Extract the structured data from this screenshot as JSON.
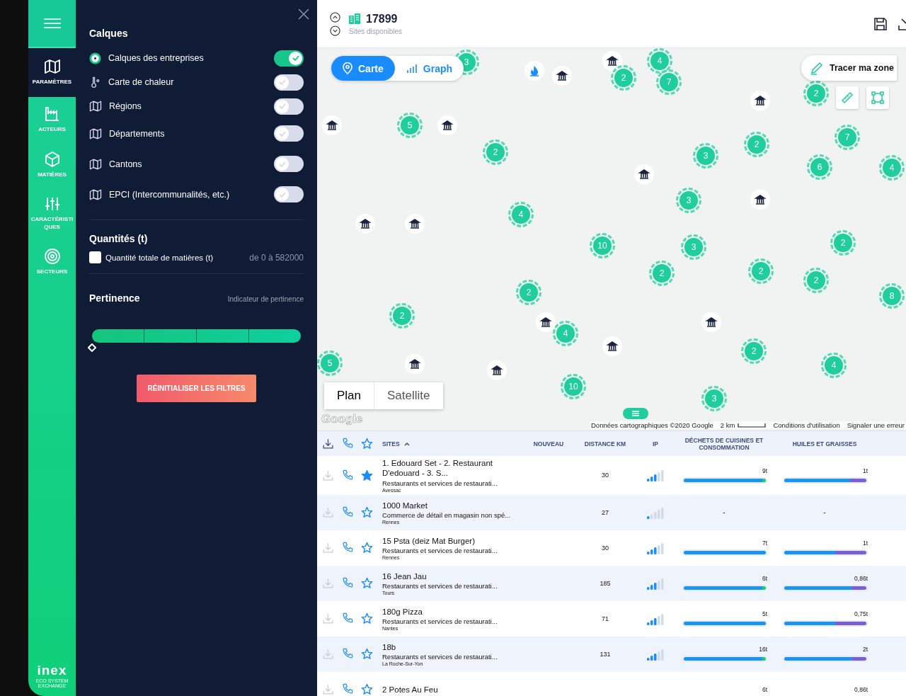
{
  "rail": {
    "items": [
      {
        "label": "PARAMÈTRES",
        "kind": "map",
        "selected": true
      },
      {
        "label": "ACTEURS",
        "kind": "factory",
        "selected": false
      },
      {
        "label": "MATIÈRES",
        "kind": "box",
        "selected": false
      },
      {
        "label": "CARACTÉRISTIQUES",
        "kind": "sliders",
        "selected": false
      },
      {
        "label": "SECTEURS",
        "kind": "target",
        "selected": false
      }
    ],
    "logo": "inex",
    "logo_tagline": "ECO SYSTEM EXCHANGE"
  },
  "panel": {
    "layers_title": "Calques",
    "layers": [
      {
        "label": "Calques des entreprises",
        "kind": "dot",
        "on": true
      },
      {
        "label": "Carte de chaleur",
        "kind": "thermometer",
        "on": false
      },
      {
        "label": "Régions",
        "kind": "map",
        "on": false
      },
      {
        "label": "Départements",
        "kind": "map",
        "on": false
      },
      {
        "label": "Cantons",
        "kind": "map",
        "on": false
      },
      {
        "label": "EPCI (Intercommunalités, etc.)",
        "kind": "map",
        "on": false
      }
    ],
    "quantities_title": "Quantités (t)",
    "quantity": {
      "label": "Quantité totale de matières (t)",
      "checked": false,
      "range": "de 0 à 582000"
    },
    "pertinence_title": "Pertinence",
    "pertinence_hint": "Indicateur de pertinence",
    "pertinence_slider": {
      "level": 0
    },
    "reset_button": "RÉINITIALISER LES FILTRES"
  },
  "header": {
    "count": "17899",
    "count_label": "Sites disponibles"
  },
  "map": {
    "view_tabs": [
      {
        "label": "Carte",
        "kind": "pin",
        "selected": true
      },
      {
        "label": "Graph",
        "kind": "bars",
        "selected": false
      }
    ],
    "draw_zone_button": "Tracer ma zone",
    "map_types": [
      {
        "label": "Plan",
        "selected": true
      },
      {
        "label": "Satellite",
        "selected": false
      }
    ],
    "clusters": [
      "3",
      "4",
      "2",
      "7",
      "2",
      "5",
      "2",
      "3",
      "2",
      "7",
      "6",
      "4",
      "3",
      "4",
      "10",
      "3",
      "2",
      "2",
      "2",
      "2",
      "8",
      "2",
      "2",
      "4",
      "2",
      "4",
      "5",
      "10",
      "3"
    ],
    "attribution": {
      "logo": "Google",
      "data": "Données cartographiques ©2020 Google",
      "scale": "2 km",
      "terms": "Conditions d'utilisation",
      "report": "Signaler une erreur"
    }
  },
  "table": {
    "columns": [
      "SITES",
      "NOUVEAU",
      "DISTANCE KM",
      "IP",
      "DÉCHETS DE CUISINES ET CONSOMMATION",
      "HUILES ET GRAISSES"
    ],
    "rows": [
      {
        "name": "1. Edouard Set - 2. Restaurant D'edouard - 3. S...",
        "category": "Restaurants et services de restaurati...",
        "city": "Avessac",
        "distance": "30",
        "ip": {
          "level": 0.6
        },
        "starred": true,
        "waste": {
          "value": "9t",
          "level": 0.96
        },
        "oil": {
          "value": "1t",
          "level": 0.8
        }
      },
      {
        "name": "1000 Market",
        "category": "Commerce de détail en magasin non spé...",
        "city": "Rennes",
        "distance": "27",
        "ip": {
          "level": 0.2
        },
        "starred": false,
        "waste": {
          "value": "-"
        },
        "oil": {
          "value": "-"
        }
      },
      {
        "name": "15 Psta (deiz Mat Burger)",
        "category": "Restaurants et services de restaurati...",
        "city": "Rennes",
        "distance": "30",
        "ip": {
          "level": 0.6
        },
        "starred": false,
        "waste": {
          "value": "7t",
          "level": 1
        },
        "oil": {
          "value": "1t",
          "level": 0.62
        }
      },
      {
        "name": "16 Jean Jau",
        "category": "Restaurants et services de restaurati...",
        "city": "Tours",
        "distance": "185",
        "ip": {
          "level": 0.6
        },
        "starred": false,
        "waste": {
          "value": "6t",
          "level": 0.96
        },
        "oil": {
          "value": "0,86t",
          "level": 0.82
        }
      },
      {
        "name": "180g Pizza",
        "category": "Restaurants et services de restaurati...",
        "city": "Nantes",
        "distance": "71",
        "ip": {
          "level": 0.6
        },
        "starred": false,
        "waste": {
          "value": "5t",
          "level": 1
        },
        "oil": {
          "value": "0,75t",
          "level": 0.62
        }
      },
      {
        "name": "18b",
        "category": "Restaurants et services de restaurati...",
        "city": "La Roche-Sur-Yon",
        "distance": "131",
        "ip": {
          "level": 0.6
        },
        "starred": false,
        "waste": {
          "value": "16t",
          "level": 0.96
        },
        "oil": {
          "value": "2t",
          "level": 0.82
        }
      },
      {
        "name": "2 Potes Au Feu",
        "starred": false,
        "waste": {
          "value": "6t"
        },
        "oil": {
          "value": "0,86t"
        }
      }
    ]
  }
}
